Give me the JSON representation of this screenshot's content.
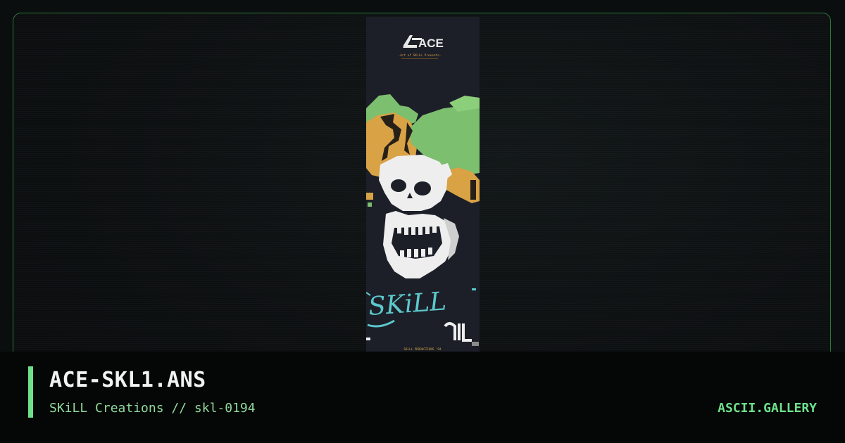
{
  "artwork": {
    "logo_text": "ACE",
    "logo_tagline": "-Art of SKiLL Presents-",
    "graffiti_text": "SKiLL",
    "footer_text": "SKiLL PRODUCTIONS '94"
  },
  "caption": {
    "title": "ACE-SKL1.ANS",
    "subtitle": "SKiLL Creations // skl-0194",
    "brand": "ASCII.GALLERY"
  },
  "colors": {
    "accent": "#6ee08a",
    "frame_border": "#2c7a3a",
    "art_background": "#1c1f28"
  }
}
